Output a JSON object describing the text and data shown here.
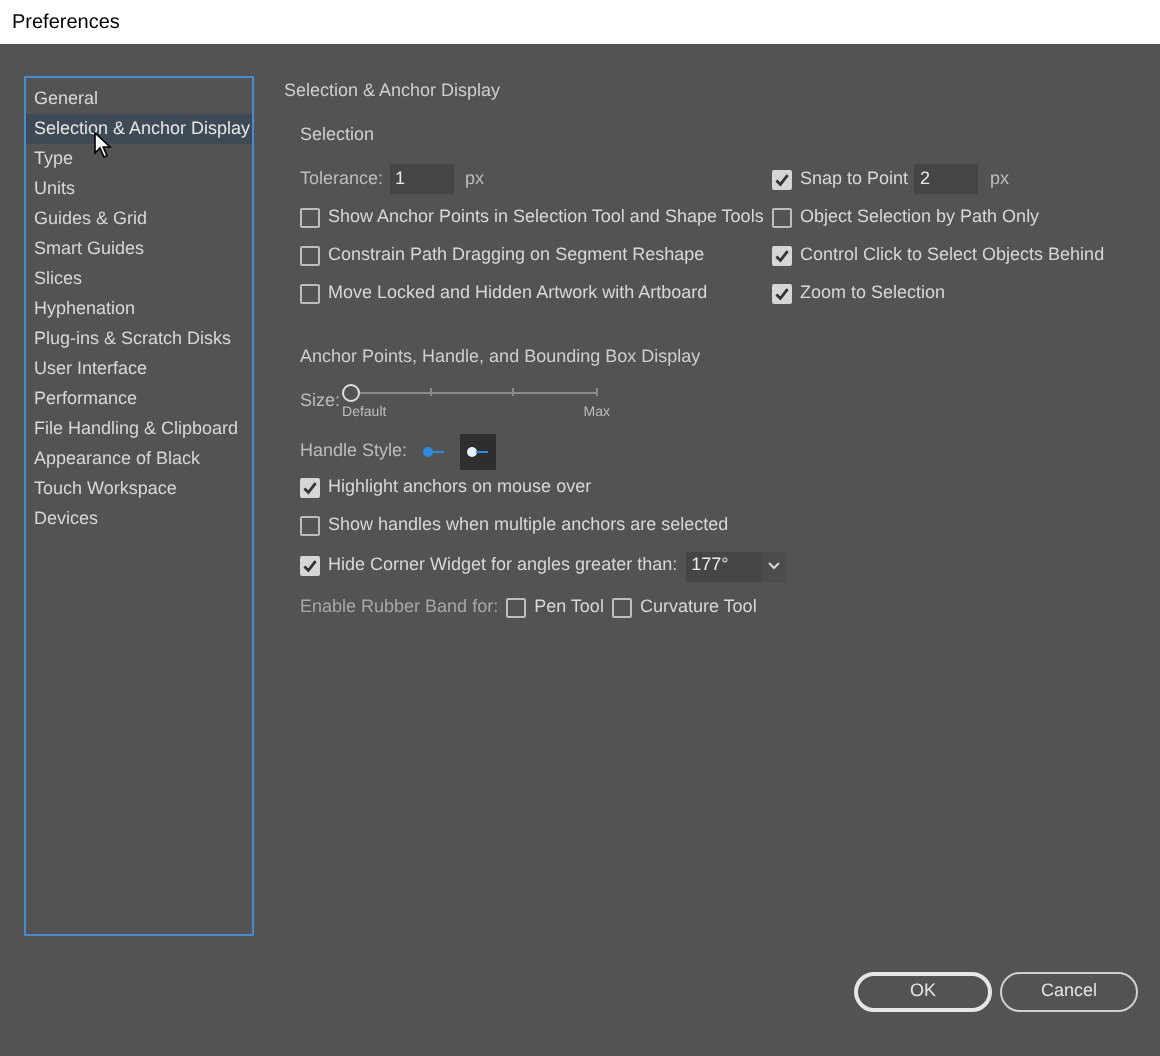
{
  "window": {
    "title": "Preferences"
  },
  "sidebar": {
    "items": [
      {
        "label": "General",
        "selected": false
      },
      {
        "label": "Selection & Anchor Display",
        "selected": true
      },
      {
        "label": "Type",
        "selected": false
      },
      {
        "label": "Units",
        "selected": false
      },
      {
        "label": "Guides & Grid",
        "selected": false
      },
      {
        "label": "Smart Guides",
        "selected": false
      },
      {
        "label": "Slices",
        "selected": false
      },
      {
        "label": "Hyphenation",
        "selected": false
      },
      {
        "label": "Plug-ins & Scratch Disks",
        "selected": false
      },
      {
        "label": "User Interface",
        "selected": false
      },
      {
        "label": "Performance",
        "selected": false
      },
      {
        "label": "File Handling & Clipboard",
        "selected": false
      },
      {
        "label": "Appearance of Black",
        "selected": false
      },
      {
        "label": "Touch Workspace",
        "selected": false
      },
      {
        "label": "Devices",
        "selected": false
      }
    ]
  },
  "page_title": "Selection & Anchor Display",
  "selection": {
    "heading": "Selection",
    "tolerance": {
      "label": "Tolerance:",
      "value": "1",
      "unit": "px"
    },
    "snap": {
      "label": "Snap to Point",
      "checked": true,
      "value": "2",
      "unit": "px"
    },
    "left_options": [
      {
        "label": "Show Anchor Points in Selection Tool and Shape Tools",
        "checked": false
      },
      {
        "label": "Constrain Path Dragging on Segment Reshape",
        "checked": false
      },
      {
        "label": "Move Locked and Hidden Artwork with Artboard",
        "checked": false
      }
    ],
    "right_options": [
      {
        "label": "Object Selection by Path Only",
        "checked": false
      },
      {
        "label": "Control Click to Select Objects Behind",
        "checked": true
      },
      {
        "label": "Zoom to Selection",
        "checked": true
      }
    ]
  },
  "anchor": {
    "heading": "Anchor Points, Handle, and Bounding Box Display",
    "size": {
      "label": "Size:",
      "level": 0,
      "min_label": "Default",
      "max_label": "Max"
    },
    "handle_style": {
      "label": "Handle Style:",
      "options": [
        {
          "selected": false
        },
        {
          "selected": true
        }
      ]
    },
    "options": [
      {
        "label": "Highlight anchors on mouse over",
        "checked": true
      },
      {
        "label": "Show handles when multiple anchors are selected",
        "checked": false
      }
    ],
    "corner_widget": {
      "label": "Hide Corner Widget for angles greater than:",
      "checked": true,
      "value": "177°"
    },
    "rubber_band": {
      "label": "Enable Rubber Band for:",
      "options": [
        {
          "label": "Pen Tool",
          "checked": false
        },
        {
          "label": "Curvature Tool",
          "checked": false
        }
      ]
    }
  },
  "buttons": [
    {
      "label": "OK",
      "kind": "primary"
    },
    {
      "label": "Cancel",
      "kind": "secondary"
    }
  ]
}
